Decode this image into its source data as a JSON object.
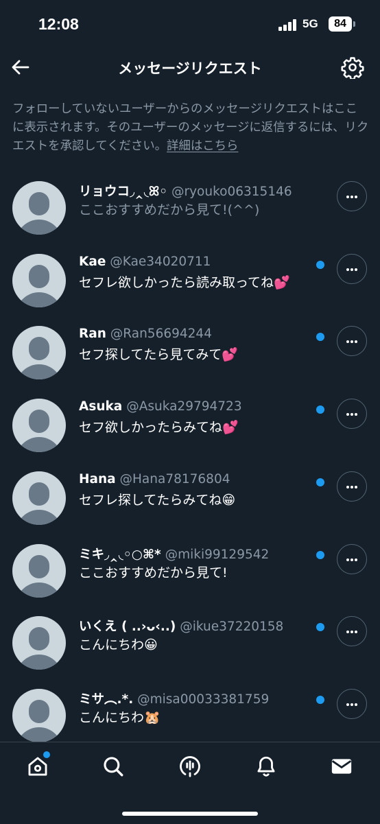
{
  "status_bar": {
    "time": "12:08",
    "network": "5G",
    "battery": "84"
  },
  "header": {
    "title": "メッセージリクエスト",
    "back_icon": "arrow-left-icon",
    "settings_icon": "gear-icon"
  },
  "notice": {
    "text": "フォローしていないユーザーからのメッセージリクエストはここに表示されます。そのユーザーのメッセージに返信するには、リクエストを承認してください。",
    "link": "詳細はこちら"
  },
  "requests": [
    {
      "name": "リョウコ◞‸◟ꕤ◦",
      "handle": "@ryouko06315146",
      "preview": "ここおすすめだから見て!(^^)",
      "unread": false
    },
    {
      "name": "Kae",
      "handle": "@Kae34020711",
      "preview": "セフレ欲しかったら読み取ってね💕",
      "unread": true
    },
    {
      "name": "Ran",
      "handle": "@Ran56694244",
      "preview": "セフ探してたら見てみて💕",
      "unread": true
    },
    {
      "name": "Asuka",
      "handle": "@Asuka29794723",
      "preview": "セフ欲しかったらみてね💕",
      "unread": true
    },
    {
      "name": "Hana",
      "handle": "@Hana78176804",
      "preview": "セフレ探してたらみてね😁",
      "unread": true
    },
    {
      "name": "ミキ◞‸◟◦○⌘*",
      "handle": "@miki99129542",
      "preview": "ここおすすめだから見て!",
      "unread": true
    },
    {
      "name": "いくえ ( ..›ᴗ‹..)",
      "handle": "@ikue37220158",
      "preview": "こんにちわ😀",
      "unread": true
    },
    {
      "name": "ミサ︵.*.",
      "handle": "@misa00033381759",
      "preview": "こんにちわ🐹",
      "unread": true
    }
  ],
  "tabbar": {
    "items": [
      "home-icon",
      "search-icon",
      "spaces-icon",
      "bell-icon",
      "mail-icon"
    ],
    "home_has_badge": true
  },
  "colors": {
    "background": "#15202b",
    "accent": "#1d9bf0",
    "muted": "#8b98a5"
  }
}
